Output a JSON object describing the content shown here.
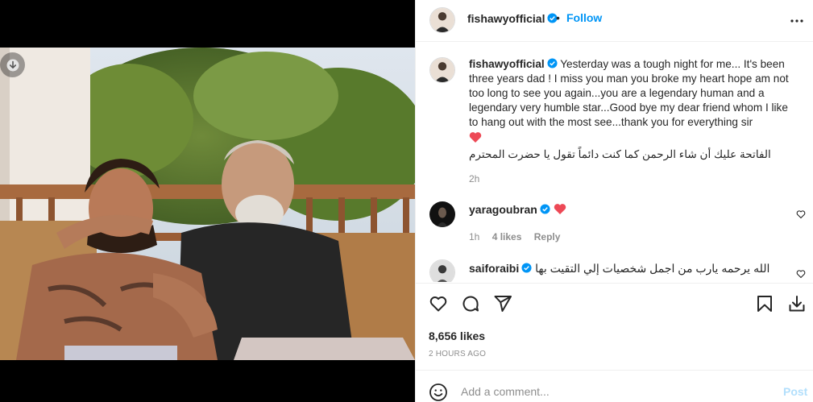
{
  "post": {
    "username": "fishawyofficial",
    "follow_label": "Follow",
    "separator": "•",
    "icons": {
      "more": "more-options-icon",
      "verified": "verified-badge-icon",
      "download": "download-icon"
    }
  },
  "caption": {
    "username": "fishawyofficial",
    "text": "Yesterday was a tough night for me... It's been three years dad ! I miss you man you broke my heart hope am not too long to see you again...you are a legendary human and a legendary very humble star...Good bye my dear friend whom I like to hang out with the most see...thank you for everything sir",
    "arabic": "الفاتحة عليك أن شاء الرحمن كما كنت دائماً تقول يا حضرت المحترم",
    "time": "2h"
  },
  "comments": [
    {
      "username": "yaragoubran",
      "text": "",
      "time": "1h",
      "likes": "4 likes",
      "reply": "Reply"
    },
    {
      "username": "saiforaibi",
      "text": "الله يرحمه يارب من اجمل شخصيات إلي التقيت بها"
    }
  ],
  "actions": {
    "likes": "8,656 likes",
    "time": "2 HOURS AGO",
    "icons": [
      "like-icon",
      "comment-icon",
      "share-icon",
      "save-icon",
      "download-icon"
    ]
  },
  "add_comment": {
    "placeholder": "Add a comment...",
    "post_label": "Post"
  },
  "colors": {
    "accent": "#0095f6",
    "heart": "#ed4956",
    "muted": "#8e8e8e",
    "post_disabled": "#b2dffc"
  }
}
